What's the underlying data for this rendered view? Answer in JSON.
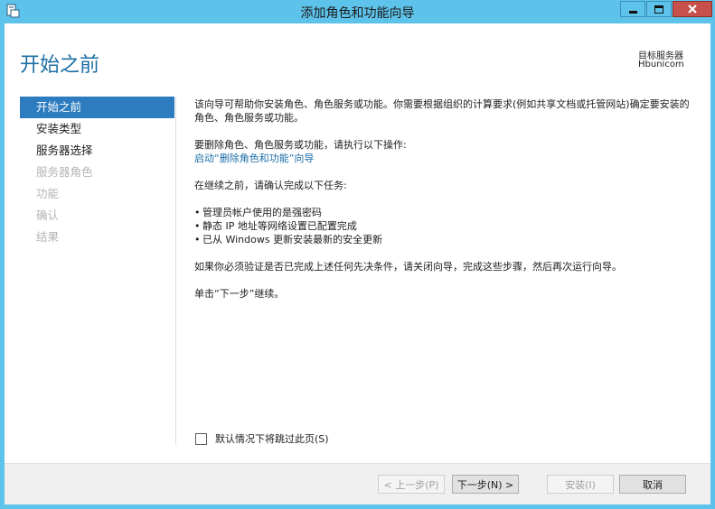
{
  "window": {
    "title": "添加角色和功能向导",
    "icons": [
      "app-icon",
      "minimize-icon",
      "maximize-icon",
      "close-icon"
    ]
  },
  "header": {
    "page_title": "开始之前",
    "destination_label": "目标服务器",
    "destination_server": "Hbunicom"
  },
  "nav": {
    "items": [
      {
        "label": "开始之前",
        "state": "active"
      },
      {
        "label": "安装类型",
        "state": "enabled"
      },
      {
        "label": "服务器选择",
        "state": "enabled"
      },
      {
        "label": "服务器角色",
        "state": "disabled"
      },
      {
        "label": "功能",
        "state": "disabled"
      },
      {
        "label": "确认",
        "state": "disabled"
      },
      {
        "label": "结果",
        "state": "disabled"
      }
    ]
  },
  "content": {
    "intro": "该向导可帮助你安装角色、角色服务或功能。你需要根据组织的计算要求(例如共享文档或托管网站)确定要安装的角色、角色服务或功能。",
    "remove_text": "要删除角色、角色服务或功能，请执行以下操作:",
    "remove_link": "启动“删除角色和功能”向导",
    "before_text": "在继续之前，请确认完成以下任务:",
    "tasks": [
      "管理员帐户使用的是强密码",
      "静态 IP 地址等网络设置已配置完成",
      "已从 Windows 更新安装最新的安全更新"
    ],
    "verify_text": "如果你必须验证是否已完成上述任何先决条件，请关闭向导，完成这些步骤，然后再次运行向导。",
    "continue_text": "单击“下一步”继续。"
  },
  "skip": {
    "label": "默认情况下将跳过此页(S)",
    "checked": false
  },
  "footer": {
    "prev_label": "< 上一步(P)",
    "next_label": "下一步(N) >",
    "install_label": "安装(I)",
    "cancel_label": "取消"
  },
  "colors": {
    "titlebar": "#5ec3ea",
    "accent": "#2d7cc0",
    "page_title": "#1d6fa5",
    "link": "#1c6ea8",
    "close_button": "#c7504b"
  }
}
